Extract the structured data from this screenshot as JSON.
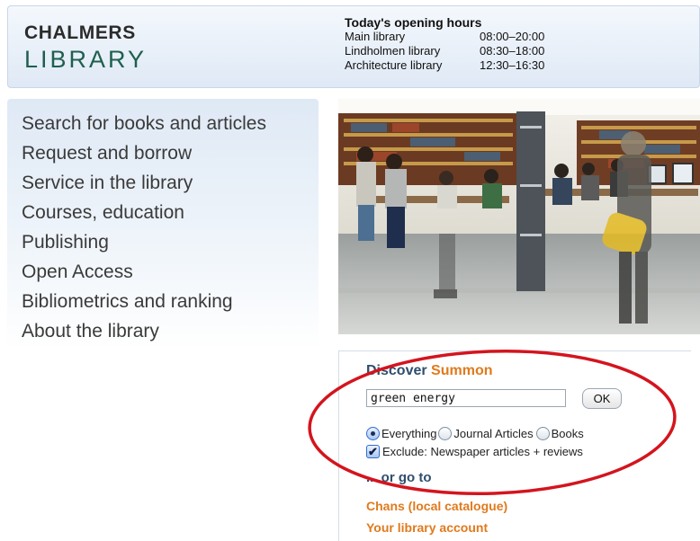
{
  "header": {
    "logo_top": "CHALMERS",
    "logo_bottom": "LIBRARY",
    "hours_title": "Today's opening hours",
    "hours": [
      {
        "name": "Main library",
        "time": "08:00–20:00"
      },
      {
        "name": "Lindholmen library",
        "time": "08:30–18:00"
      },
      {
        "name": "Architecture library",
        "time": "12:30–16:30"
      }
    ]
  },
  "nav": {
    "items": [
      "Search for books and articles",
      "Request and borrow",
      "Service in the library",
      "Courses, education",
      "Publishing",
      "Open Access",
      "Bibliometrics and ranking",
      "About the library"
    ]
  },
  "search": {
    "discover": "Discover",
    "brand": "Summon",
    "query": "green energy",
    "ok_label": "OK",
    "options": [
      "Everything",
      "Journal Articles",
      "Books"
    ],
    "selected_option": "Everything",
    "exclude_label": "Exclude: Newspaper articles + reviews",
    "exclude_checked": true,
    "or_go_to": "... or go to",
    "links": [
      "Chans (local catalogue)",
      "Your library account"
    ]
  },
  "colors": {
    "brand_orange": "#e07a1d",
    "heading_blue": "#2f4e6d",
    "logo_green": "#1f5f4e",
    "annotation_red": "#d4141e"
  }
}
